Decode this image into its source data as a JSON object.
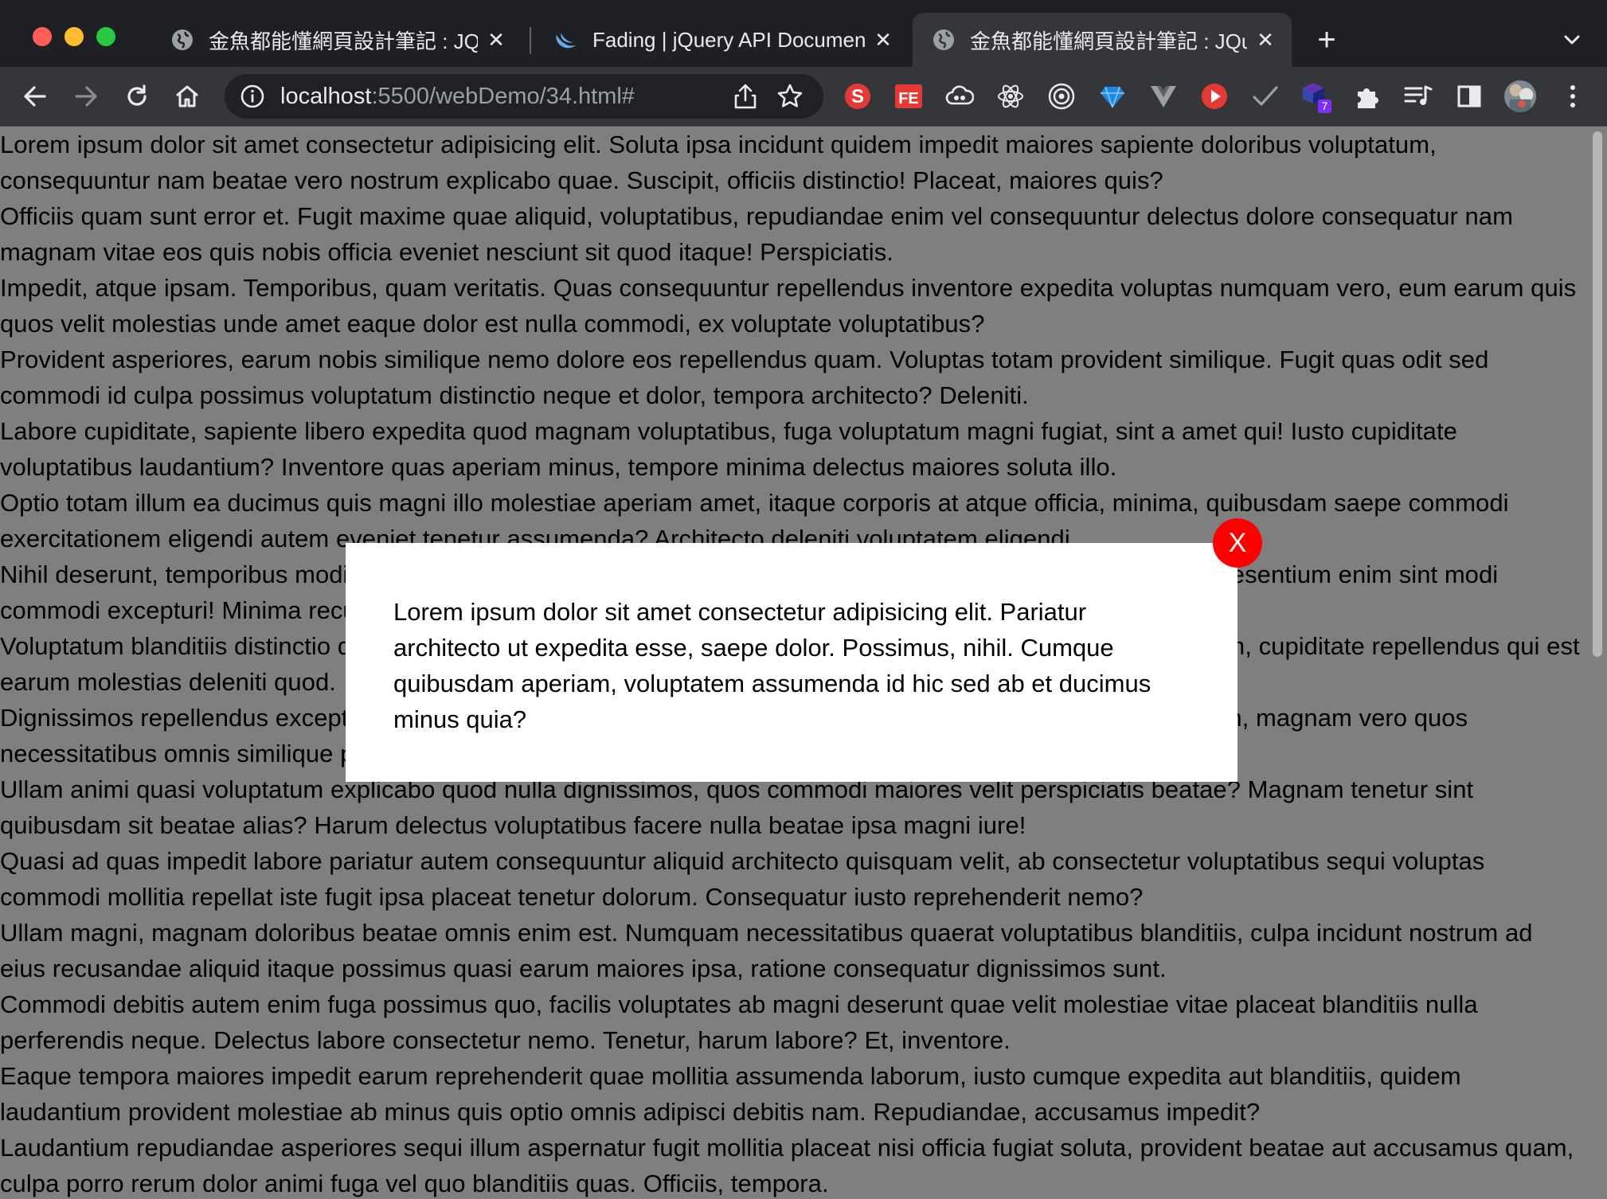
{
  "tabs": [
    {
      "title": "金魚都能懂網頁設計筆記 : JQuery",
      "favicon": "globe-icon",
      "close": "✕",
      "active": false
    },
    {
      "title": "Fading | jQuery API Documentation",
      "favicon": "jquery-icon",
      "close": "✕",
      "active": false
    },
    {
      "title": "金魚都能懂網頁設計筆記 : JQuery",
      "favicon": "globe-icon",
      "close": "✕",
      "active": true
    }
  ],
  "new_tab": "+",
  "toolbar": {
    "url_host": "localhost",
    "url_path": ":5500/webDemo/34.html#"
  },
  "extensions": {
    "badge_count": "7"
  },
  "page": {
    "paragraphs": [
      "Lorem ipsum dolor sit amet consectetur adipisicing elit. Soluta ipsa incidunt quidem impedit maiores sapiente doloribus voluptatum, consequuntur nam beatae vero nostrum explicabo quae. Suscipit, officiis distinctio! Placeat, maiores quis?",
      "Officiis quam sunt error et. Fugit maxime quae aliquid, voluptatibus, repudiandae enim vel consequuntur delectus dolore consequatur nam magnam vitae eos quis nobis officia eveniet nesciunt sit quod itaque! Perspiciatis.",
      "Impedit, atque ipsam. Temporibus, quam veritatis. Quas consequuntur repellendus inventore expedita voluptas numquam vero, eum earum quis quos velit molestias unde amet eaque dolor est nulla commodi, ex voluptate voluptatibus?",
      "Provident asperiores, earum nobis similique nemo dolore eos repellendus quam. Voluptas totam provident similique. Fugit quas odit sed commodi id culpa possimus voluptatum distinctio neque et dolor, tempora architecto? Deleniti.",
      "Labore cupiditate, sapiente libero expedita quod magnam voluptatibus, fuga voluptatum magni fugiat, sint a amet qui! Iusto cupiditate voluptatibus laudantium? Inventore quas aperiam minus, tempore minima delectus maiores soluta illo.",
      "Optio totam illum ea ducimus quis magni illo molestiae aperiam amet, itaque corporis at atque officia, minima, quibusdam saepe commodi exercitationem eligendi autem eveniet tenetur assumenda? Architecto deleniti voluptatem eligendi.",
      "Nihil deserunt, temporibus modi dolorem nostrum corporis laboriosam dignissimos quasi asperiores nesciunt praesentium enim sint modi commodi excepturi! Minima recusandae eius aspernatur adipisci dolorum tempore eaque?",
      "Voluptatum blanditiis distinctio debitis sapiente exercitationem iure asperiores veniam aliquid commodi nam quam, cupiditate repellendus qui est earum molestias deleniti quod.",
      "Dignissimos repellendus excepturi dolorum eum velit obcaecati quibusdam molestias consectetur voluptatum non, magnam vero quos necessitatibus omnis similique pariatur ducimus nesciunt atque minus officiis?",
      "Ullam animi quasi voluptatum explicabo quod nulla dignissimos, quos commodi maiores velit perspiciatis beatae? Magnam tenetur sint quibusdam sit beatae alias? Harum delectus voluptatibus facere nulla beatae ipsa magni iure!",
      "Quasi ad quas impedit labore pariatur autem consequuntur aliquid architecto quisquam velit, ab consectetur voluptatibus sequi voluptas commodi mollitia repellat iste fugit ipsa placeat tenetur dolorum. Consequatur iusto reprehenderit nemo?",
      "Ullam magni, magnam doloribus beatae omnis enim est. Numquam necessitatibus quaerat voluptatibus blanditiis, culpa incidunt nostrum ad eius recusandae aliquid itaque possimus quasi earum maiores ipsa, ratione consequatur dignissimos sunt.",
      "Commodi debitis autem enim fuga possimus quo, facilis voluptates ab magni deserunt quae velit molestiae vitae placeat blanditiis nulla perferendis neque. Delectus labore consectetur nemo. Tenetur, harum labore? Et, inventore.",
      "Eaque tempora maiores impedit earum reprehenderit quae mollitia assumenda laborum, iusto cumque expedita aut blanditiis, quidem laudantium provident molestiae ab minus quis optio omnis adipisci debitis nam. Repudiandae, accusamus impedit?",
      "Laudantium repudiandae asperiores sequi illum aspernatur fugit mollitia placeat nisi officia fugiat soluta, provident beatae aut accusamus quam, culpa porro rerum dolor animi fuga vel quo blanditiis quas. Officiis, tempora."
    ]
  },
  "modal": {
    "text": "Lorem ipsum dolor sit amet consectetur adipisicing elit. Pariatur architecto ut expedita esse, saepe dolor. Possimus, nihil. Cumque quibusdam aperiam, voluptatem assumenda id hic sed ab et ducimus minus quia?",
    "close_label": "X",
    "close_color": "#ff0000"
  },
  "colors": {
    "overlay": "rgba(0,0,0,0.5)",
    "tabstrip": "#1f2023",
    "toolbar": "#35363a"
  }
}
